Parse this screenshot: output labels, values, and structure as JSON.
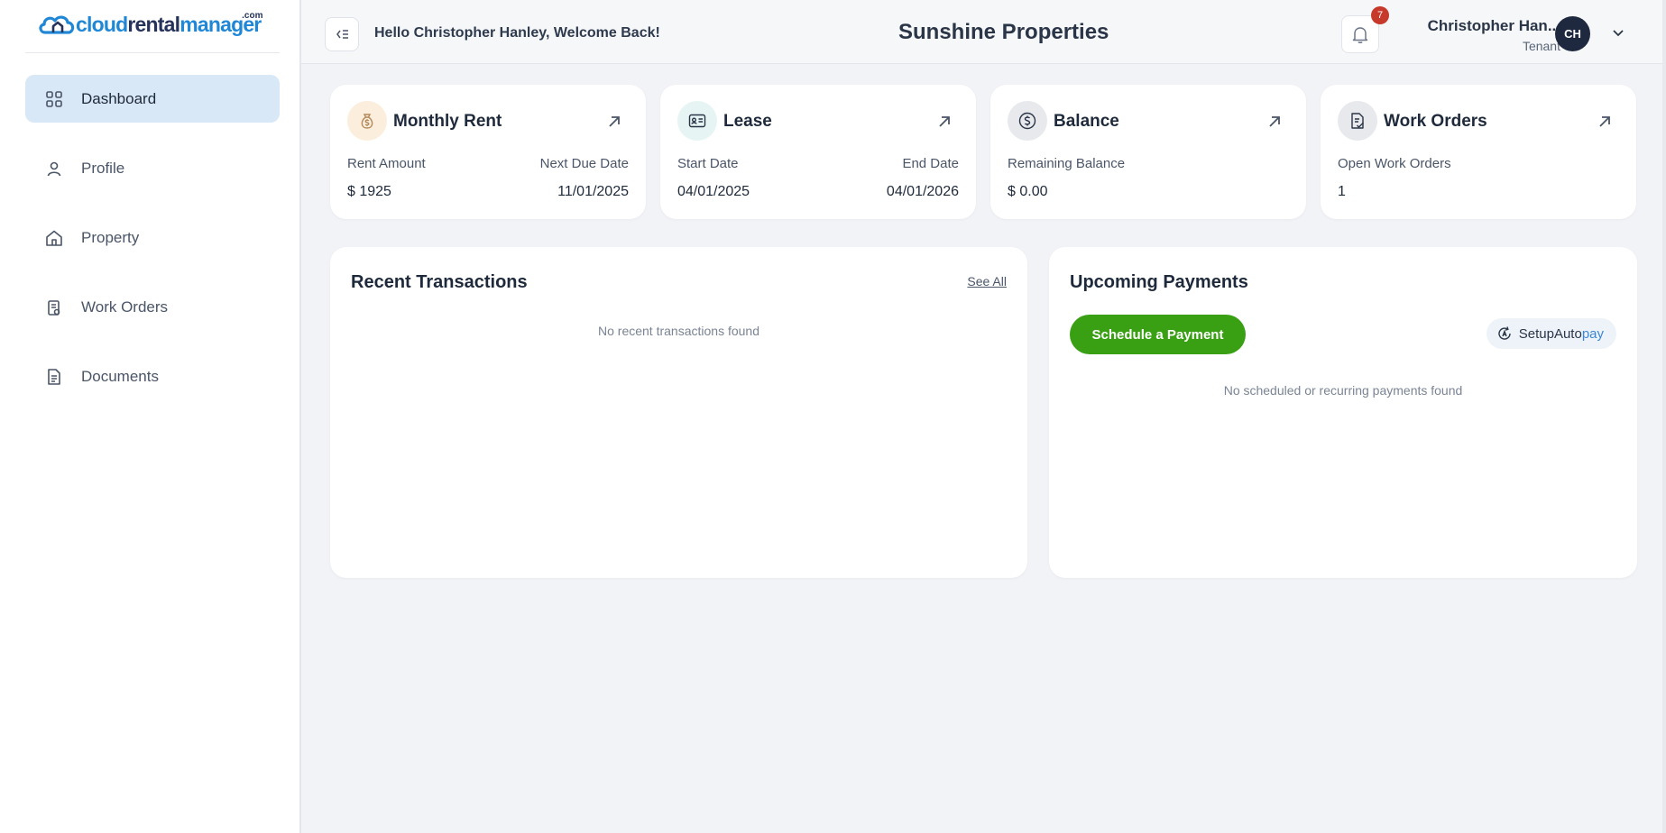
{
  "brand": {
    "logo_part1": "cloud",
    "logo_part2": "rental",
    "logo_part3": "manager",
    "logo_suffix": ".com"
  },
  "sidebar": {
    "items": [
      {
        "label": "Dashboard",
        "icon": "grid-icon",
        "active": true
      },
      {
        "label": "Profile",
        "icon": "user-icon"
      },
      {
        "label": "Property",
        "icon": "home-icon"
      },
      {
        "label": "Work Orders",
        "icon": "clipboard-icon"
      },
      {
        "label": "Documents",
        "icon": "document-icon"
      }
    ]
  },
  "header": {
    "greeting": "Hello Christopher Hanley, Welcome Back!",
    "company": "Sunshine Properties",
    "notification_count": "7",
    "user_name": "Christopher Han...",
    "user_role": "Tenant",
    "avatar_initials": "CH"
  },
  "cards": {
    "rent": {
      "title": "Monthly Rent",
      "label_left": "Rent Amount",
      "value_left": "$ 1925",
      "label_right": "Next Due Date",
      "value_right": "11/01/2025"
    },
    "lease": {
      "title": "Lease",
      "label_left": "Start Date",
      "value_left": "04/01/2025",
      "label_right": "End Date",
      "value_right": "04/01/2026"
    },
    "balance": {
      "title": "Balance",
      "label_left": "Remaining Balance",
      "value_left": "$ 0.00"
    },
    "workorders": {
      "title": "Work Orders",
      "label_left": "Open Work Orders",
      "value_left": "1"
    }
  },
  "transactions": {
    "title": "Recent Transactions",
    "see_all": "See All",
    "empty": "No recent transactions found"
  },
  "payments": {
    "title": "Upcoming Payments",
    "schedule_button": "Schedule a Payment",
    "autopay_part1": "SetupAuto",
    "autopay_part2": "pay",
    "empty": "No scheduled or recurring payments found"
  },
  "colors": {
    "accent_blue": "#1f87d6",
    "active_nav": "#d9e8f7",
    "primary_green": "#39a013",
    "badge_red": "#c6392b",
    "avatar_bg": "#1e2940"
  }
}
